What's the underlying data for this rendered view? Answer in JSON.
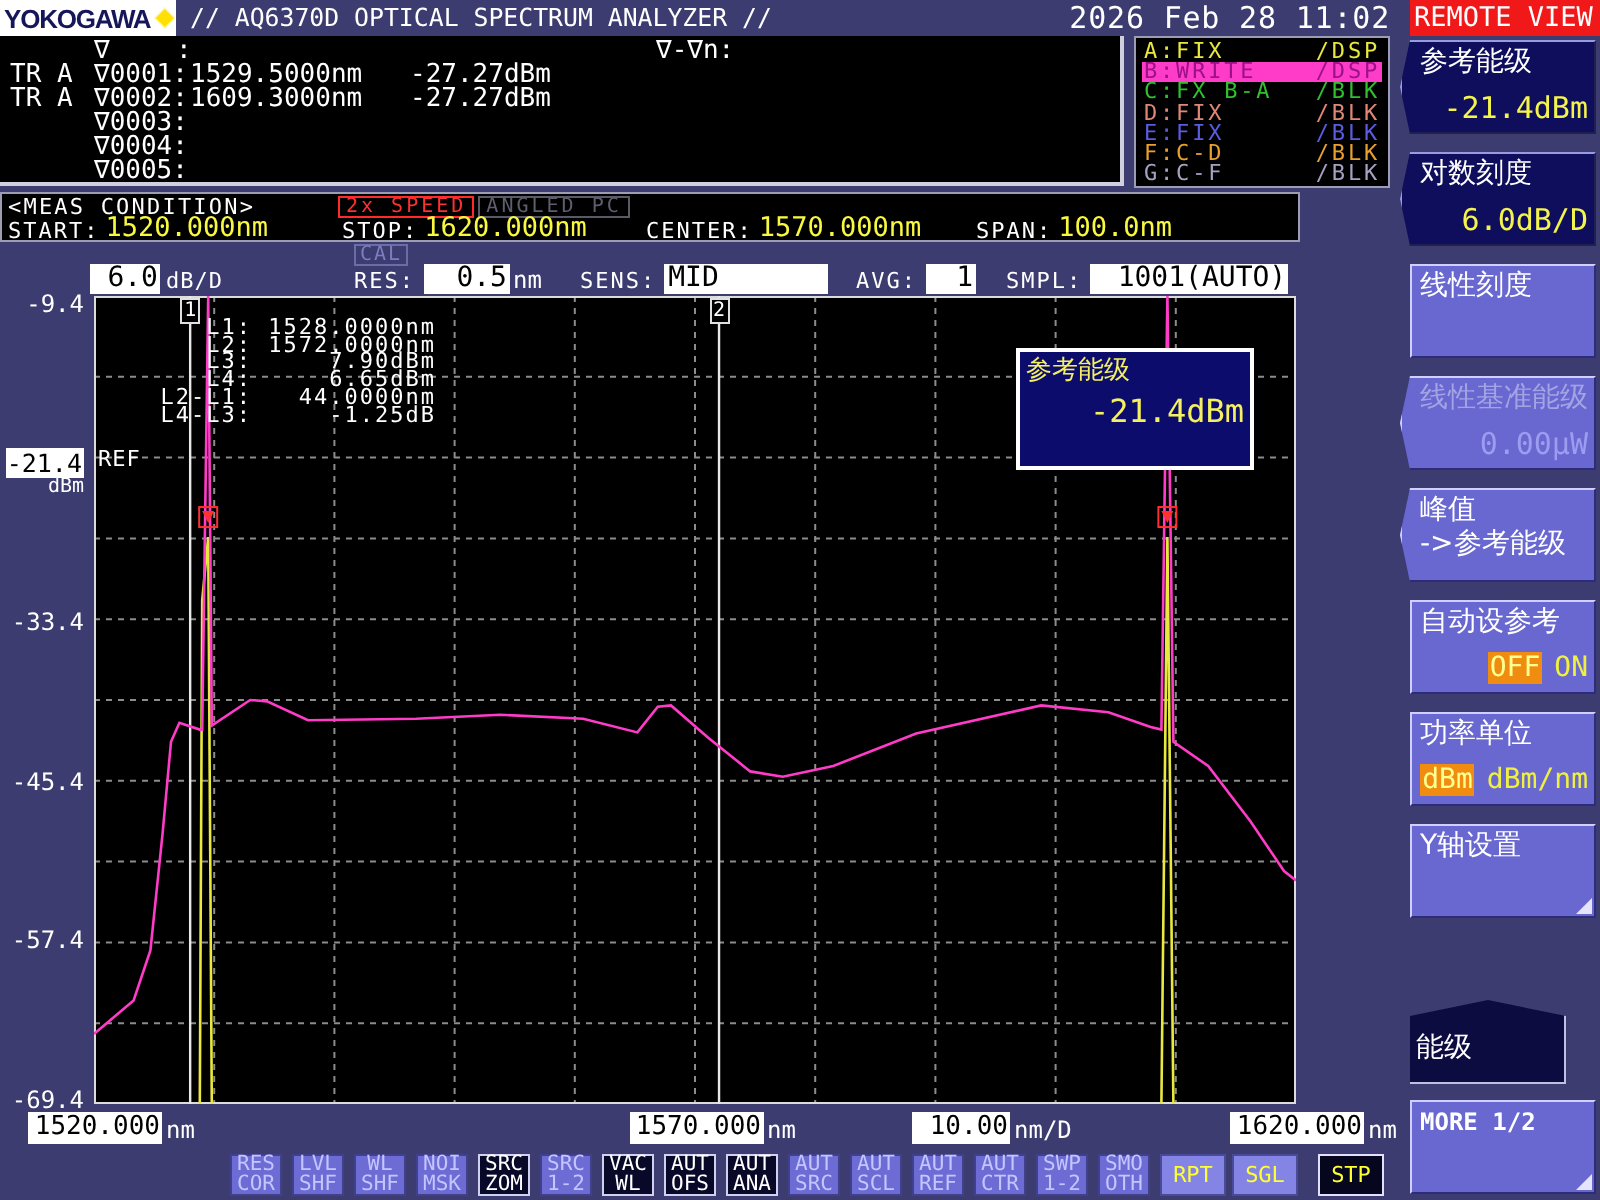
{
  "header": {
    "logo": "YOKOGAWA",
    "title": "// AQ6370D OPTICAL SPECTRUM ANALYZER //",
    "datetime": "2026 Feb 28 11:02",
    "remote_badge": "REMOTE VIEW"
  },
  "marker_table": {
    "header_symbol": "∇",
    "header_separator": ":",
    "delta_header": "∇-∇n:",
    "rows": [
      {
        "trace": "TR A",
        "marker": "∇0001:",
        "wavelength": "1529.5000nm",
        "level": "-27.27dBm"
      },
      {
        "trace": "TR A",
        "marker": "∇0002:",
        "wavelength": "1609.3000nm",
        "level": "-27.27dBm"
      },
      {
        "marker": "∇0003:"
      },
      {
        "marker": "∇0004:"
      },
      {
        "marker": "∇0005:"
      }
    ]
  },
  "traces": [
    {
      "mode": "A:FIX",
      "display": "/DSP",
      "color": "#e8e840",
      "selected": false
    },
    {
      "mode": "B:WRITE",
      "display": "/DSP",
      "color": "#ff3cc8",
      "selected": true
    },
    {
      "mode": "C:FX B-A",
      "display": "/BLK",
      "color": "#30c030",
      "selected": false
    },
    {
      "mode": "D:FIX",
      "display": "/BLK",
      "color": "#e08878",
      "selected": false
    },
    {
      "mode": "E:FIX",
      "display": "/BLK",
      "color": "#5c5ce0",
      "selected": false
    },
    {
      "mode": "F:C-D",
      "display": "/BLK",
      "color": "#e8a030",
      "selected": false
    },
    {
      "mode": "G:C-F",
      "display": "/BLK",
      "color": "#a8a0c0",
      "selected": false
    }
  ],
  "meas_condition": {
    "title": "<MEAS CONDITION>",
    "badges": [
      {
        "label": "2x SPEED",
        "on": true
      },
      {
        "label": "ANGLED PC",
        "on": false
      }
    ],
    "params": [
      {
        "label": "START:",
        "value": "1520.000nm"
      },
      {
        "label": "STOP:",
        "value": "1620.000nm"
      },
      {
        "label": "CENTER:",
        "value": "1570.000nm"
      },
      {
        "label": "SPAN:",
        "value": "100.0nm"
      }
    ]
  },
  "settings_bar": {
    "scale": {
      "value": "6.0",
      "unit": "dB/D"
    },
    "fields": [
      {
        "label": "RES:",
        "value": "0.5",
        "unit": "nm",
        "badge": "CAL"
      },
      {
        "label": "SENS:",
        "value": "MID"
      },
      {
        "label": "AVG:",
        "value": "1"
      },
      {
        "label": "SMPL:",
        "value": "1001(AUTO)"
      }
    ]
  },
  "spectrum": {
    "ref_level": {
      "value": "-21.4",
      "unit": "dBm"
    },
    "line_marker_tags": [
      "1",
      "2"
    ],
    "line_marker_readout": [
      {
        "label": "L1:",
        "value": "1528.0000nm"
      },
      {
        "label": "L2:",
        "value": "1572.0000nm"
      },
      {
        "label": "L3:",
        "value": "7.90dBm"
      },
      {
        "label": "L4:",
        "value": "6.65dBm"
      },
      {
        "label": "L2-L1:",
        "value": "44.0000nm"
      },
      {
        "label": "L4-L3:",
        "value": "-1.25dB"
      }
    ],
    "popup": {
      "label": "参考能级",
      "value": "-21.4dBm"
    },
    "chart_data": {
      "type": "line",
      "grid": true,
      "xlim": [
        1520,
        1620
      ],
      "ylim": [
        -69.4,
        -9.4
      ],
      "xticks": [
        {
          "value": 1520,
          "label": "1520.000"
        },
        {
          "value": 1570,
          "label": "1570.000"
        },
        {
          "value": 1620,
          "label": "1620.000"
        }
      ],
      "yticks": [
        {
          "value": -9.4,
          "label": "-9.4"
        },
        {
          "value": -33.4,
          "label": "-33.4"
        },
        {
          "value": -45.4,
          "label": "-45.4"
        },
        {
          "value": -57.4,
          "label": "-57.4"
        },
        {
          "value": -69.4,
          "label": "-69.4"
        }
      ],
      "x": [
        1520,
        1523.3,
        1524.7,
        1525.7,
        1526.4,
        1527.1,
        1528.8,
        1529.0,
        1529.5,
        1529.8,
        1533,
        1534.4,
        1537.8,
        1546.8,
        1553.8,
        1560.7,
        1565.2,
        1566.9,
        1568,
        1571.1,
        1574.6,
        1577.3,
        1581.5,
        1588.4,
        1598.8,
        1604.4,
        1607.9,
        1608.8,
        1609.3,
        1609.8,
        1612.7,
        1616.2,
        1619,
        1620
      ],
      "series": [
        {
          "color": "#e8e840",
          "values": [
            null,
            null,
            null,
            null,
            null,
            null,
            -69.4,
            -32.0,
            -27.3,
            -69.4,
            null,
            null,
            null,
            null,
            null,
            null,
            null,
            null,
            null,
            null,
            null,
            null,
            null,
            null,
            null,
            null,
            null,
            -69.4,
            -27.3,
            -69.4,
            null,
            null,
            null,
            null
          ]
        },
        {
          "color": "#ff3cc8",
          "values": [
            -64.2,
            -61.7,
            -58.0,
            -49.3,
            -42.5,
            -41.1,
            -41.6,
            -41.6,
            -9.4,
            -41.3,
            -39.4,
            -39.5,
            -40.9,
            -40.8,
            -40.5,
            -40.8,
            -41.8,
            -39.9,
            -39.8,
            -42.2,
            -44.7,
            -45.1,
            -44.3,
            -41.9,
            -39.8,
            -40.3,
            -41.4,
            -41.6,
            -9.4,
            -42.5,
            -44.3,
            -48.4,
            -52.1,
            -52.8
          ]
        }
      ],
      "ref_lines": [
        {
          "axis": "x",
          "value": 1528
        },
        {
          "axis": "x",
          "value": 1572
        },
        {
          "axis": "y",
          "value": -21.4,
          "label": "REF"
        }
      ]
    }
  },
  "x_axis": {
    "tick_units": [
      "nm",
      "nm",
      "nm"
    ],
    "division": {
      "value": "10.00",
      "unit": "nm/D"
    }
  },
  "function_buttons": [
    {
      "label": "RES COR",
      "on": false
    },
    {
      "label": "LVL SHF",
      "on": false
    },
    {
      "label": "WL SHF",
      "on": false
    },
    {
      "label": "NOI MSK",
      "on": false
    },
    {
      "label": "SRC ZOM",
      "on": true
    },
    {
      "label": "SRC 1-2",
      "on": false
    },
    {
      "label": "VAC WL",
      "on": true
    },
    {
      "label": "AUT OFS",
      "on": true
    },
    {
      "label": "AUT ANA",
      "on": true
    },
    {
      "label": "AUT SRC",
      "on": false
    },
    {
      "label": "AUT SCL",
      "on": false
    },
    {
      "label": "AUT REF",
      "on": false
    },
    {
      "label": "AUT CTR",
      "on": false
    },
    {
      "label": "SWP 1-2",
      "on": false
    },
    {
      "label": "SMO OTH",
      "on": false
    }
  ],
  "sweep_buttons": [
    {
      "label": "RPT",
      "on": false
    },
    {
      "label": "SGL",
      "on": false
    },
    {
      "label": "STP",
      "on": true
    }
  ],
  "soft_keys": [
    {
      "kind": "value",
      "label": "参考能级",
      "value": "-21.4dBm",
      "selected": true,
      "notched": true,
      "disabled": false
    },
    {
      "kind": "value",
      "label": "对数刻度",
      "value": "6.0dB/D",
      "selected": true,
      "notched": true,
      "disabled": false
    },
    {
      "kind": "plain",
      "label": "线性刻度",
      "selected": false,
      "notched": false,
      "disabled": false
    },
    {
      "kind": "value",
      "label": "线性基准能级",
      "value": "0.00μW",
      "selected": false,
      "notched": true,
      "disabled": true
    },
    {
      "kind": "plain",
      "label": "峰值 ->参考能级",
      "selected": false,
      "notched": true,
      "disabled": false
    },
    {
      "kind": "toggle",
      "label": "自动设参考",
      "options": [
        {
          "label": "OFF",
          "selected": true
        },
        {
          "label": "ON",
          "selected": false
        }
      ],
      "selected": false,
      "notched": false,
      "disabled": false
    },
    {
      "kind": "toggle",
      "label": "功率单位",
      "options": [
        {
          "label": "dBm",
          "selected": true
        },
        {
          "label": "dBm/nm",
          "selected": false
        }
      ],
      "selected": false,
      "notched": false,
      "disabled": false
    },
    {
      "kind": "submenu",
      "label": "Y轴设置",
      "selected": false,
      "notched": false,
      "disabled": false
    }
  ],
  "menu_title": "能级",
  "more_key": {
    "label": "MORE 1/2"
  }
}
